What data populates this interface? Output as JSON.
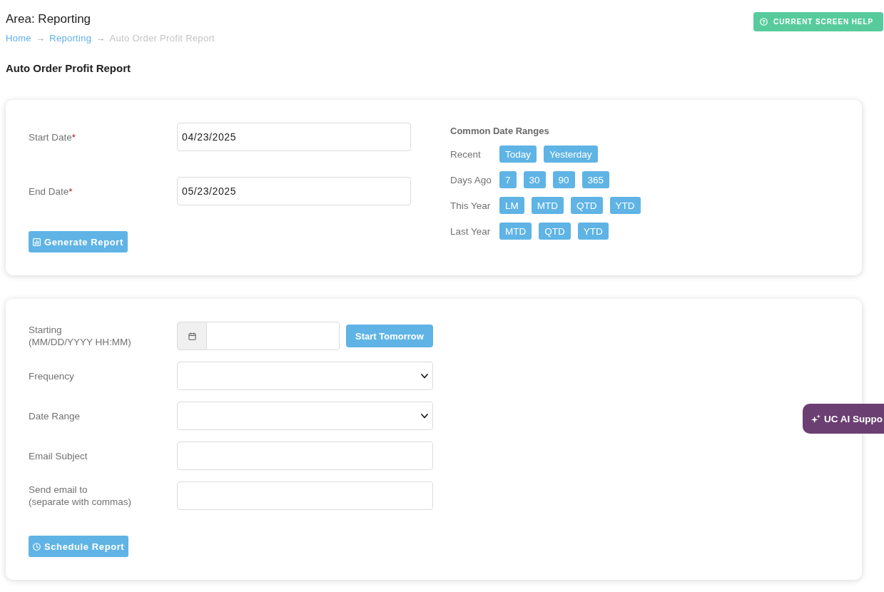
{
  "header": {
    "area_title": "Area: Reporting",
    "breadcrumb": [
      {
        "kind": "link",
        "label": "Home"
      },
      {
        "kind": "separator",
        "label": "→"
      },
      {
        "kind": "link",
        "label": "Reporting"
      },
      {
        "kind": "separator",
        "label": "→"
      },
      {
        "kind": "current",
        "label": "Auto Order Profit Report"
      }
    ],
    "help_button": "CURRENT SCREEN HELP"
  },
  "page_title": "Auto Order Profit Report",
  "report_form": {
    "fields": [
      {
        "label": "Start Date",
        "required_mark": "*",
        "value": "04/23/2025"
      },
      {
        "label": "End Date",
        "required_mark": "*",
        "value": "05/23/2025"
      }
    ],
    "generate_button": "Generate Report",
    "common_date_ranges": {
      "title": "Common Date Ranges",
      "groups": [
        {
          "label": "Recent",
          "buttons": [
            "Today",
            "Yesterday"
          ]
        },
        {
          "label": "Days Ago",
          "buttons": [
            "7",
            "30",
            "90",
            "365"
          ]
        },
        {
          "label": "This Year",
          "buttons": [
            "LM",
            "MTD",
            "QTD",
            "YTD"
          ]
        },
        {
          "label": "Last Year",
          "buttons": [
            "MTD",
            "QTD",
            "YTD"
          ]
        }
      ]
    }
  },
  "schedule_form": {
    "fields": [
      {
        "kind": "datetime",
        "label": "Starting",
        "hint": "(MM/DD/YYYY HH:MM)",
        "button": "Start Tomorrow"
      },
      {
        "kind": "select",
        "label": "Frequency"
      },
      {
        "kind": "select",
        "label": "Date Range"
      },
      {
        "kind": "text",
        "label": "Email Subject"
      },
      {
        "kind": "text",
        "label": "Send email to",
        "hint": "(separate with commas)"
      }
    ],
    "schedule_button": "Schedule Report"
  },
  "ai_support_tab": "UC AI Suppo"
}
